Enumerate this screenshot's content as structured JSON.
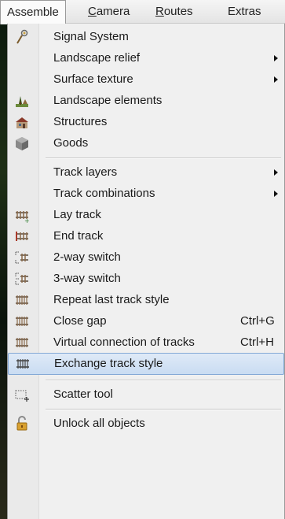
{
  "menubar": {
    "items": [
      {
        "label": "Assemble",
        "underline": ""
      },
      {
        "label": "amera",
        "underline": "C"
      },
      {
        "label": "outes",
        "underline": "R"
      },
      {
        "label": "Extras",
        "underline": ""
      }
    ]
  },
  "menu": {
    "items": [
      {
        "label": "Signal System",
        "icon": "signal-icon"
      },
      {
        "label": "Landscape relief",
        "has_submenu": true
      },
      {
        "label": "Surface texture",
        "has_submenu": true
      },
      {
        "label": "Landscape elements",
        "icon": "landscape-elements-icon"
      },
      {
        "label": "Structures",
        "icon": "structures-icon"
      },
      {
        "label": "Goods",
        "icon": "goods-icon"
      },
      {
        "label": "Track layers",
        "has_submenu": true
      },
      {
        "label": "Track combinations",
        "has_submenu": true
      },
      {
        "label": "Lay track",
        "icon": "lay-track-icon"
      },
      {
        "label": "End track",
        "icon": "end-track-icon"
      },
      {
        "label": "2-way switch",
        "icon": "two-way-switch-icon"
      },
      {
        "label": "3-way switch",
        "icon": "three-way-switch-icon"
      },
      {
        "label": "Repeat last track style",
        "icon": "repeat-track-icon"
      },
      {
        "label": "Close gap",
        "shortcut": "Ctrl+G",
        "icon": "close-gap-icon"
      },
      {
        "label": "Virtual connection of tracks",
        "shortcut": "Ctrl+H",
        "icon": "virtual-connection-icon"
      },
      {
        "label": "Exchange track style",
        "icon": "exchange-track-icon",
        "highlighted": true
      },
      {
        "label": "Scatter tool",
        "icon": "scatter-tool-icon"
      },
      {
        "label": "Unlock all objects",
        "icon": "unlock-icon"
      }
    ]
  },
  "colors": {
    "menu_bg": "#f0f0f0",
    "highlight_bg": "#c9dcf2",
    "highlight_border": "#84a9d6"
  }
}
